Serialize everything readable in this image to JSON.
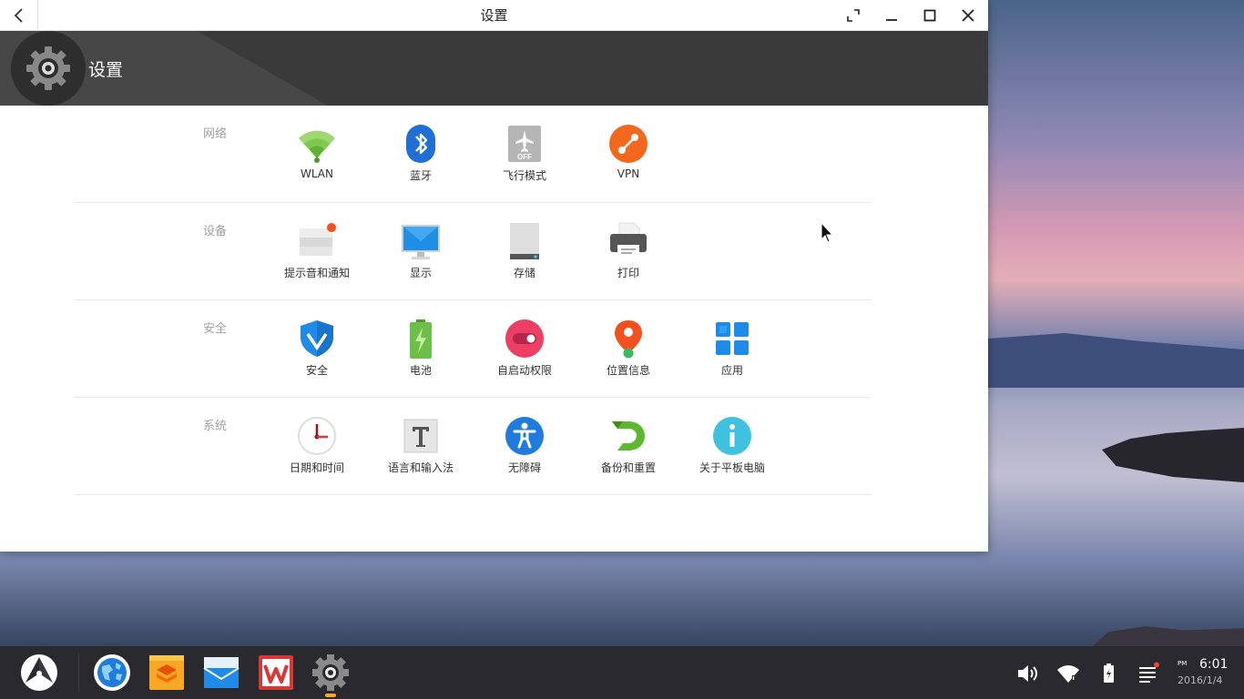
{
  "window": {
    "title": "设置",
    "header_title": "设置"
  },
  "sections": [
    {
      "label": "网络",
      "items": [
        {
          "label": "WLAN",
          "icon": "wifi-icon"
        },
        {
          "label": "蓝牙",
          "icon": "bluetooth-icon"
        },
        {
          "label": "飞行模式",
          "icon": "airplane-mode-icon",
          "badge": "OFF"
        },
        {
          "label": "VPN",
          "icon": "vpn-icon"
        }
      ]
    },
    {
      "label": "设备",
      "items": [
        {
          "label": "提示音和通知",
          "icon": "notification-icon"
        },
        {
          "label": "显示",
          "icon": "display-icon"
        },
        {
          "label": "存储",
          "icon": "storage-icon"
        },
        {
          "label": "打印",
          "icon": "printer-icon"
        }
      ]
    },
    {
      "label": "安全",
      "items": [
        {
          "label": "安全",
          "icon": "security-shield-icon"
        },
        {
          "label": "电池",
          "icon": "battery-icon"
        },
        {
          "label": "自启动权限",
          "icon": "autostart-toggle-icon"
        },
        {
          "label": "位置信息",
          "icon": "location-pin-icon"
        },
        {
          "label": "应用",
          "icon": "apps-grid-icon"
        }
      ]
    },
    {
      "label": "系统",
      "items": [
        {
          "label": "日期和时间",
          "icon": "clock-icon"
        },
        {
          "label": "语言和输入法",
          "icon": "language-text-icon"
        },
        {
          "label": "无障碍",
          "icon": "accessibility-icon"
        },
        {
          "label": "备份和重置",
          "icon": "backup-reset-icon"
        },
        {
          "label": "关于平板电脑",
          "icon": "about-info-icon"
        }
      ]
    }
  ],
  "taskbar": {
    "apps": [
      "start-menu-icon",
      "browser-globe-icon",
      "file-manager-icon",
      "mail-icon",
      "wps-office-icon",
      "settings-gear-icon"
    ],
    "tray": [
      "volume-icon",
      "wifi-tray-icon",
      "battery-tray-icon",
      "notifications-tray-icon"
    ],
    "clock": {
      "ampm": "PM",
      "time": "6:01",
      "date": "2016/1/4"
    }
  },
  "colors": {
    "header_bg": "#3a3a3a",
    "taskbar_bg": "#2a2a2e",
    "accent_blue": "#1f7bdc",
    "accent_orange": "#f4681d",
    "accent_green": "#6cc04a"
  }
}
